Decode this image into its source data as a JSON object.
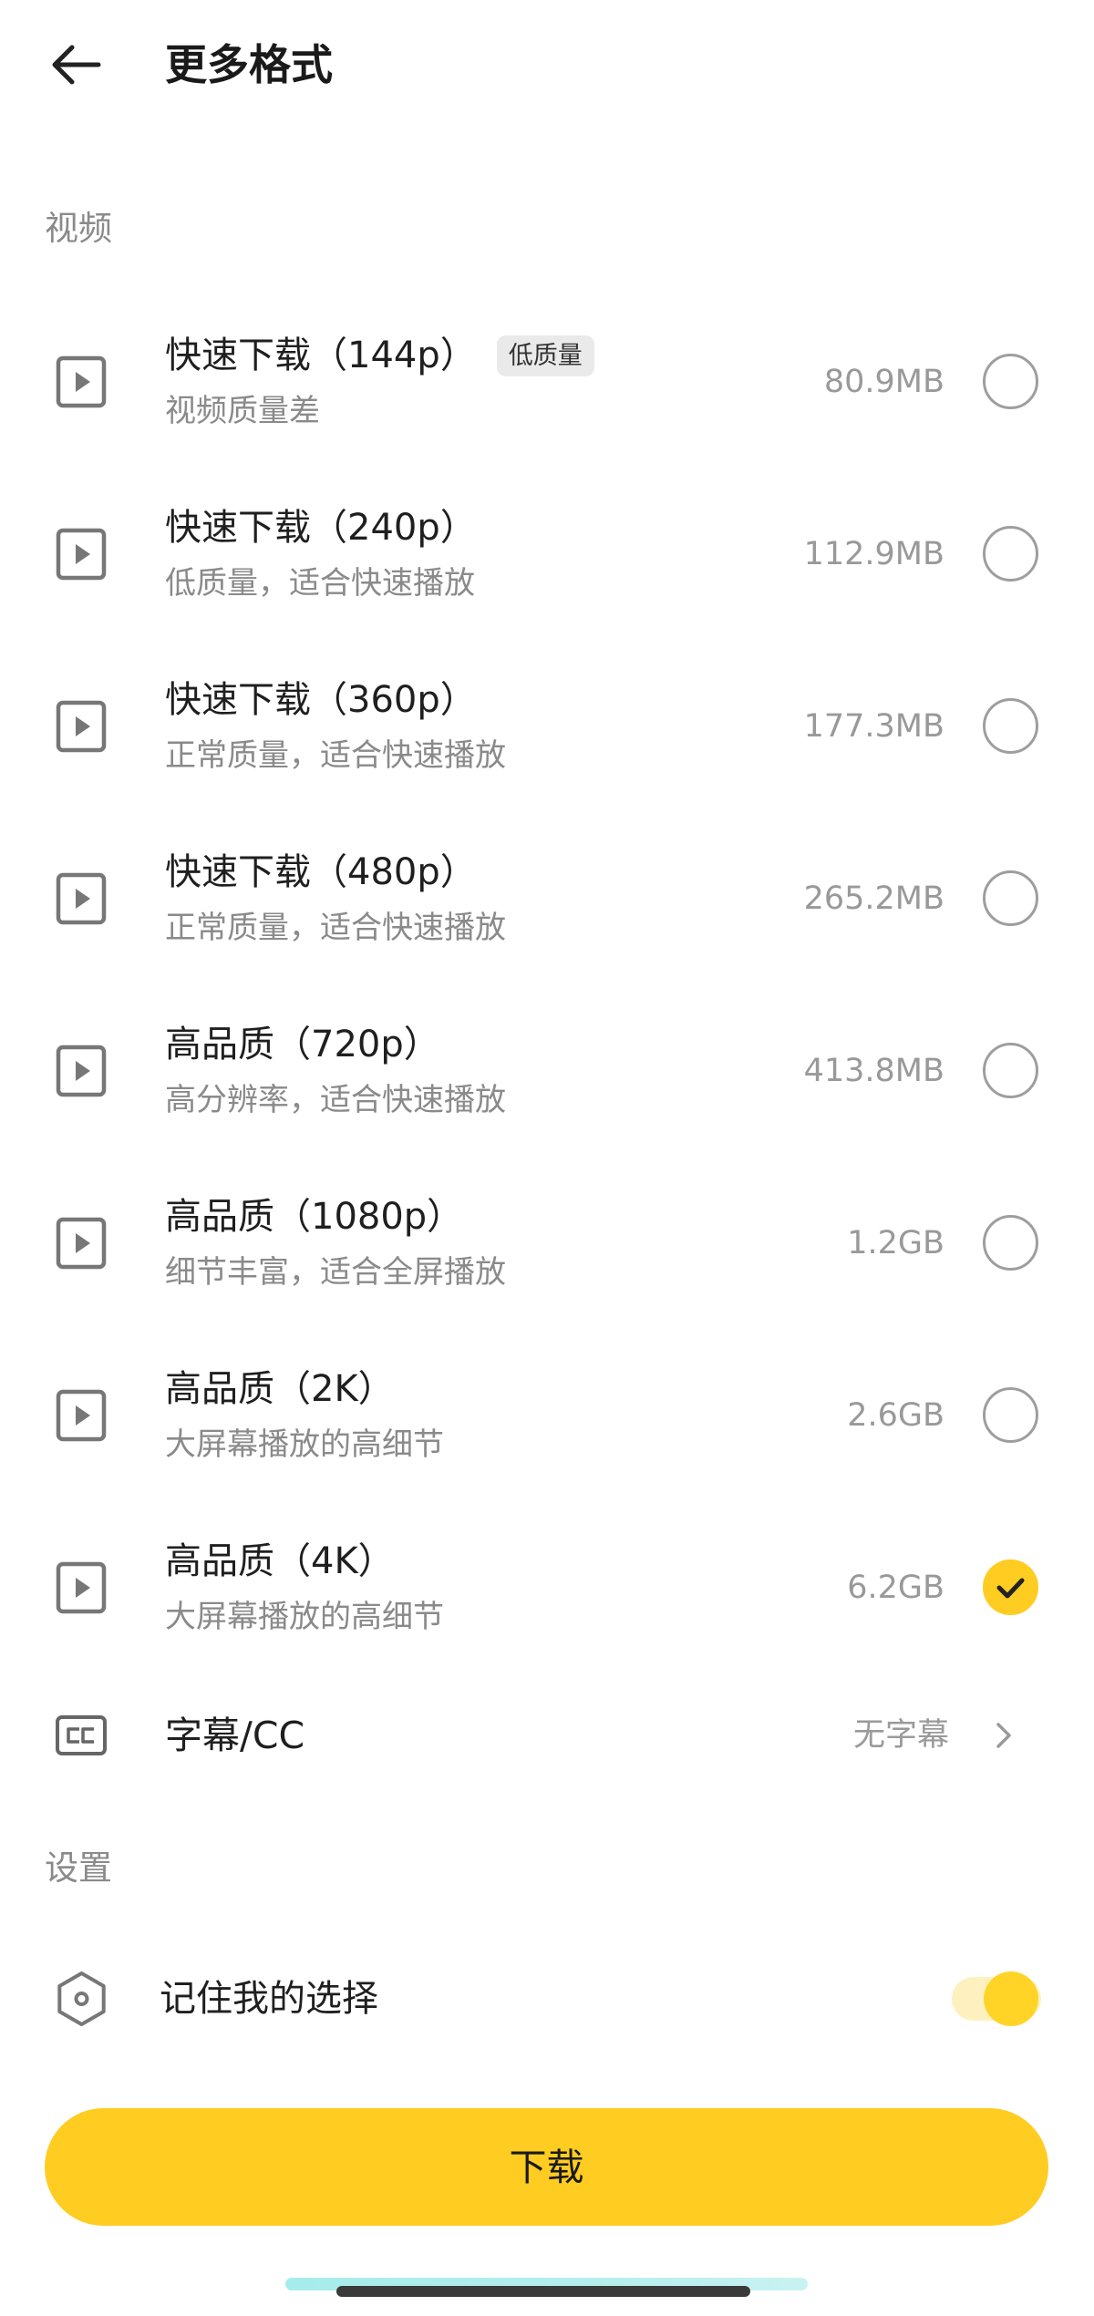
{
  "header": {
    "title": "更多格式",
    "back_icon": "arrow-left-icon"
  },
  "video": {
    "section_label": "视频",
    "option_icon": "play-icon",
    "options": [
      {
        "title": "快速下载（144p）",
        "badge": "低质量",
        "subtitle": "视频质量差",
        "size": "80.9MB",
        "selected": false
      },
      {
        "title": "快速下载（240p）",
        "subtitle": "低质量，适合快速播放",
        "size": "112.9MB",
        "selected": false
      },
      {
        "title": "快速下载（360p）",
        "subtitle": "正常质量，适合快速播放",
        "size": "177.3MB",
        "selected": false
      },
      {
        "title": "快速下载（480p）",
        "subtitle": "正常质量，适合快速播放",
        "size": "265.2MB",
        "selected": false
      },
      {
        "title": "高品质（720p）",
        "subtitle": "高分辨率，适合快速播放",
        "size": "413.8MB",
        "selected": false
      },
      {
        "title": "高品质（1080p）",
        "subtitle": "细节丰富，适合全屏播放",
        "size": "1.2GB",
        "selected": false
      },
      {
        "title": "高品质（2K）",
        "subtitle": "大屏幕播放的高细节",
        "size": "2.6GB",
        "selected": false
      },
      {
        "title": "高品质（4K）",
        "subtitle": "大屏幕播放的高细节",
        "size": "6.2GB",
        "selected": true
      }
    ]
  },
  "captions": {
    "label": "字幕/CC",
    "value": "无字幕",
    "icon": "closed-caption-icon",
    "chevron_icon": "chevron-right-icon"
  },
  "settings": {
    "section_label": "设置",
    "remember": {
      "label": "记住我的选择",
      "icon": "hexagon-settings-icon",
      "enabled": true
    }
  },
  "download_button": {
    "label": "下载"
  },
  "colors": {
    "accent": "#FFCC22",
    "toggle_track": "#FFF1BF",
    "text_primary": "#1F1F1F",
    "text_secondary": "#8A8A8A"
  }
}
